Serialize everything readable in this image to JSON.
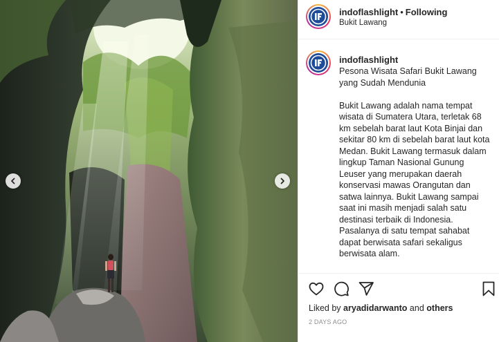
{
  "post": {
    "username": "indoflashlight",
    "separator": "•",
    "follow_status": "Following",
    "location": "Bukit Lawang",
    "avatar_initials": "iF"
  },
  "caption": {
    "username": "indoflashlight",
    "title": "Pesona Wisata Safari Bukit Lawang yang Sudah Mendunia",
    "paragraphs": [
      "Bukit Lawang adalah nama tempat wisata di Sumatera Utara, terletak 68 km sebelah barat laut Kota Binjai dan sekitar 80 km di sebelah barat laut kota Medan. Bukit Lawang termasuk dalam lingkup Taman Nasional Gunung Leuser yang merupakan daerah konservasi mawas Orangutan dan satwa lainnya. Bukit Lawang sampai saat ini masih menjadi salah satu destinasi terbaik di Indonesia. Pasalanya di satu tempat sahabat dapat berwisata safari sekaligus berwisata alam."
    ]
  },
  "engagement": {
    "liked_by_prefix": "Liked by",
    "liked_by_user": "aryadidarwanto",
    "liked_by_joiner": "and",
    "liked_by_others": "others",
    "timestamp": "2 DAYS AGO"
  },
  "media": {
    "description_icons": [
      "carousel-prev-icon",
      "carousel-next-icon"
    ]
  },
  "colors": {
    "avatar_blue": "#1f4c98",
    "text": "#262626",
    "muted": "#8e8e8e",
    "divider": "#efefef"
  }
}
